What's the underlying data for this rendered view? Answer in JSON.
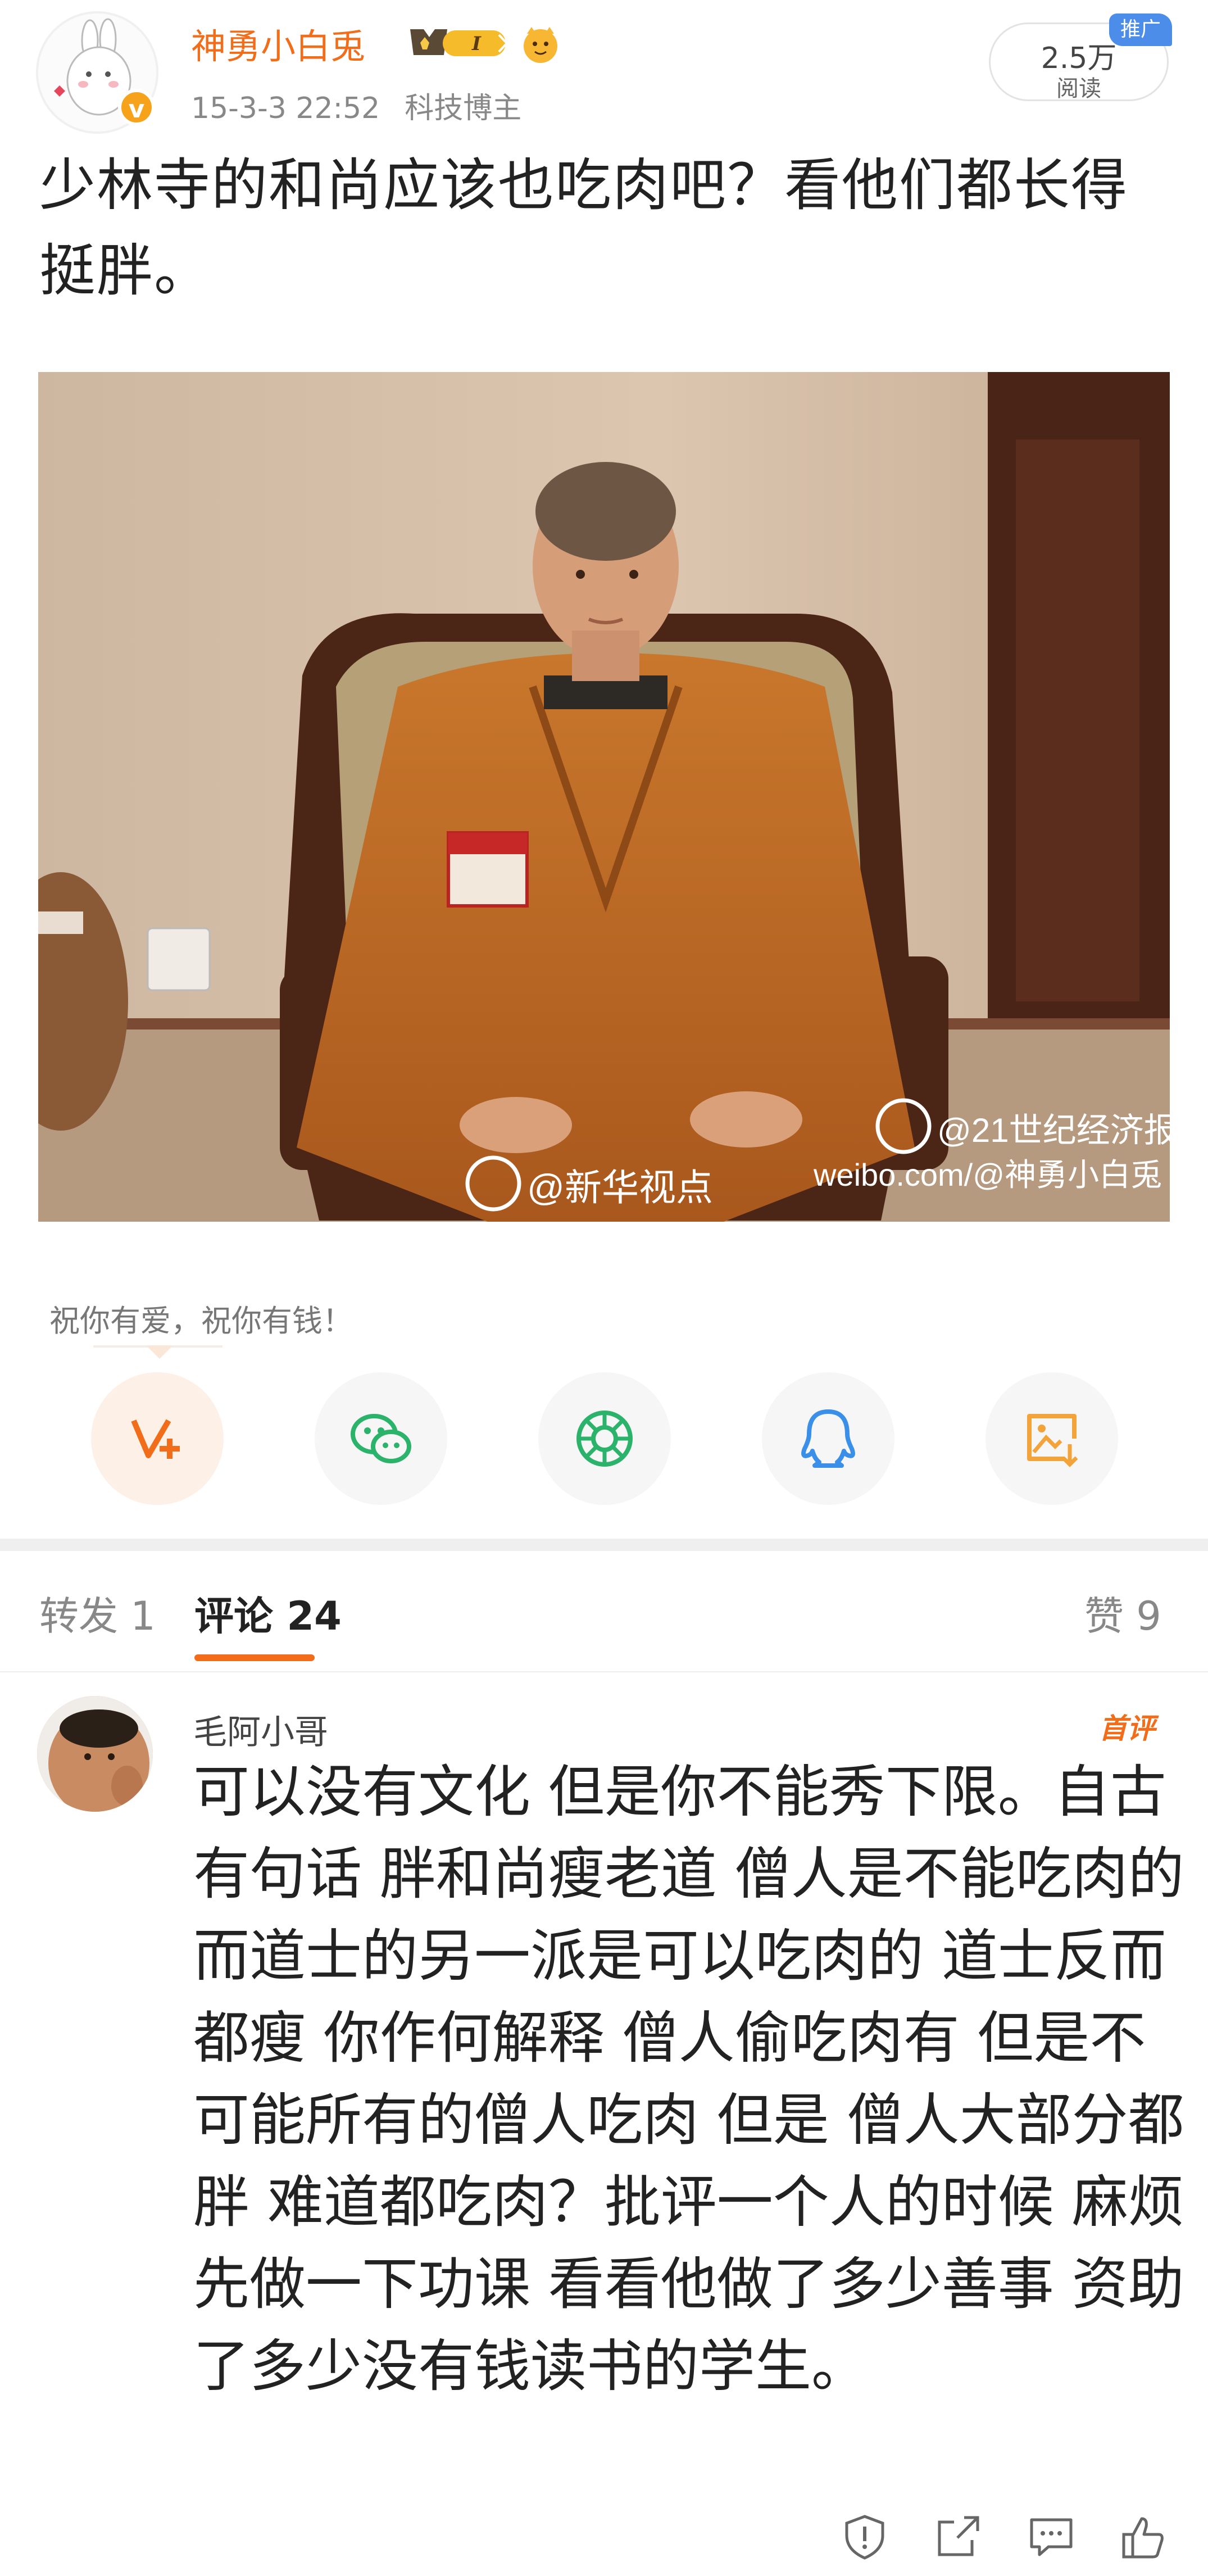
{
  "post": {
    "author": "神勇小白兎",
    "member_badge": "I",
    "verified_mark": "v",
    "date": "15-3-3 22:52",
    "category": "科技博主",
    "reads_count": "2.5万",
    "reads_label": "阅读",
    "promo_tag": "推广",
    "text": "少林寺的和尚应该也吃肉吧？看他们都长得挺胖。",
    "photo_watermark_1": "@新华视点",
    "photo_watermark_2": "@21世纪经济报道",
    "photo_watermark_3": "weibo.com/@神勇小白兎"
  },
  "share": {
    "hint": "祝你有爱，祝你有钱！",
    "buttons": [
      "weibo-vplus-icon",
      "wechat-icon",
      "moments-icon",
      "qq-icon",
      "save-image-icon"
    ]
  },
  "tabs": {
    "repost": "转发 1",
    "comments": "评论 24",
    "likes": "赞 9"
  },
  "comment": {
    "user": "毛阿小哥",
    "first_badge": "首评",
    "text": "可以没有文化 但是你不能秀下限。自古有句话 胖和尚瘦老道 僧人是不能吃肉的 而道士的另一派是可以吃肉的 道士反而都瘦 你作何解释 僧人偷吃肉有 但是不可能所有的僧人吃肉 但是 僧人大部分都胖 难道都吃肉？批评一个人的时候 麻烦先做一下功课 看看他做了多少善事 资助了多少没有钱读书的学生。",
    "actions": [
      "report-icon",
      "forward-icon",
      "reply-icon",
      "like-icon"
    ]
  },
  "colors": {
    "accent": "#f26d1a",
    "promo": "#4b8de8",
    "wechat": "#2bb36b",
    "qq": "#3a8fe8",
    "vplus": "#f26d1a"
  }
}
